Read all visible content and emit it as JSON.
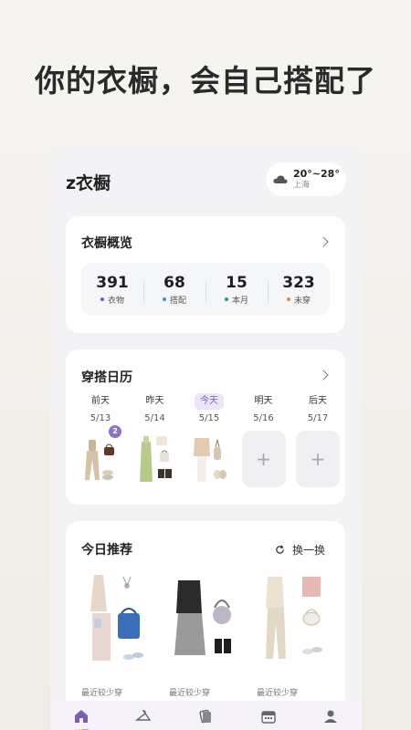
{
  "hero_title": "你的衣橱，会自己搭配了",
  "app": {
    "title": "z衣橱",
    "weather": {
      "temp": "20°~28°",
      "city": "上海",
      "icon": "cloud-icon"
    }
  },
  "overview": {
    "title": "衣橱概览",
    "stats": [
      {
        "value": "391",
        "label": "衣物",
        "color": "#6d5bd0"
      },
      {
        "value": "68",
        "label": "搭配",
        "color": "#3a8fd6"
      },
      {
        "value": "15",
        "label": "本月",
        "color": "#1f9b86"
      },
      {
        "value": "323",
        "label": "未穿",
        "color": "#f0844a"
      }
    ]
  },
  "calendar": {
    "title": "穿搭日历",
    "days": [
      {
        "name": "前天",
        "date": "5/13",
        "badge": "2"
      },
      {
        "name": "昨天",
        "date": "5/14"
      },
      {
        "name": "今天",
        "date": "5/15",
        "today": true
      },
      {
        "name": "明天",
        "date": "5/16",
        "empty": true,
        "add": "+"
      },
      {
        "name": "后天",
        "date": "5/17",
        "empty": true,
        "add": "+"
      }
    ]
  },
  "recommend": {
    "title": "今日推荐",
    "refresh_label": "换一换",
    "items": [
      {
        "caption": "最近较少穿"
      },
      {
        "caption": "最近较少穿"
      },
      {
        "caption": "最近较少穿"
      }
    ]
  },
  "tabbar": {
    "active_label": "首页",
    "tabs": [
      "home-icon",
      "hanger-icon",
      "cards-icon",
      "calendar-icon",
      "profile-icon"
    ],
    "accent": "#7a5fb5"
  }
}
